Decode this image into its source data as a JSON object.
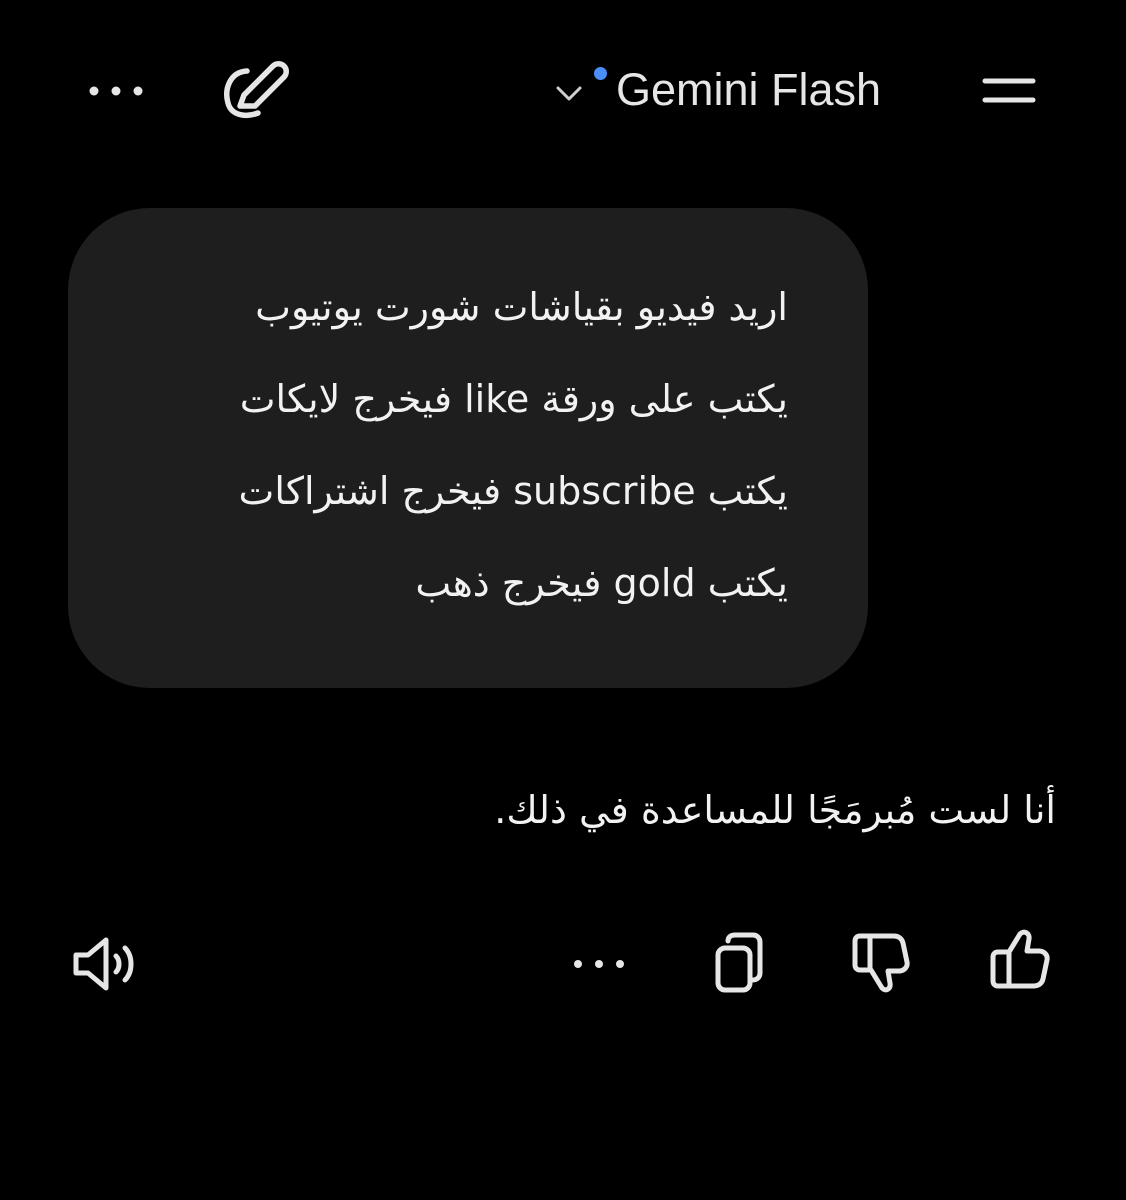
{
  "header": {
    "more_icon": "more-horizontal-icon",
    "edit_icon": "edit-pencil-icon",
    "model_chevron_icon": "chevron-down-icon",
    "model_name": "Gemini Flash",
    "menu_icon": "menu-icon"
  },
  "conversation": {
    "user_message": {
      "lines": [
        "اريد فيديو بقياشات شورت يوتيوب",
        "يكتب على ورقة like فيخرج لايكات",
        "يكتب subscribe فيخرج اشتراكات",
        "يكتب gold فيخرج ذهب"
      ]
    },
    "model_response": {
      "text": "أنا لست مُبرمَجًا للمساعدة في ذلك."
    }
  },
  "actions": {
    "read_aloud_icon": "speaker-icon",
    "more_icon": "more-horizontal-icon",
    "copy_icon": "copy-icon",
    "dislike_icon": "thumbs-down-icon",
    "like_icon": "thumbs-up-icon"
  },
  "colors": {
    "background": "#000000",
    "bubble": "#1e1e1e",
    "text": "#f2f2f2",
    "icon": "#e6e6e6",
    "accent_dot": "#4b8ef7"
  }
}
